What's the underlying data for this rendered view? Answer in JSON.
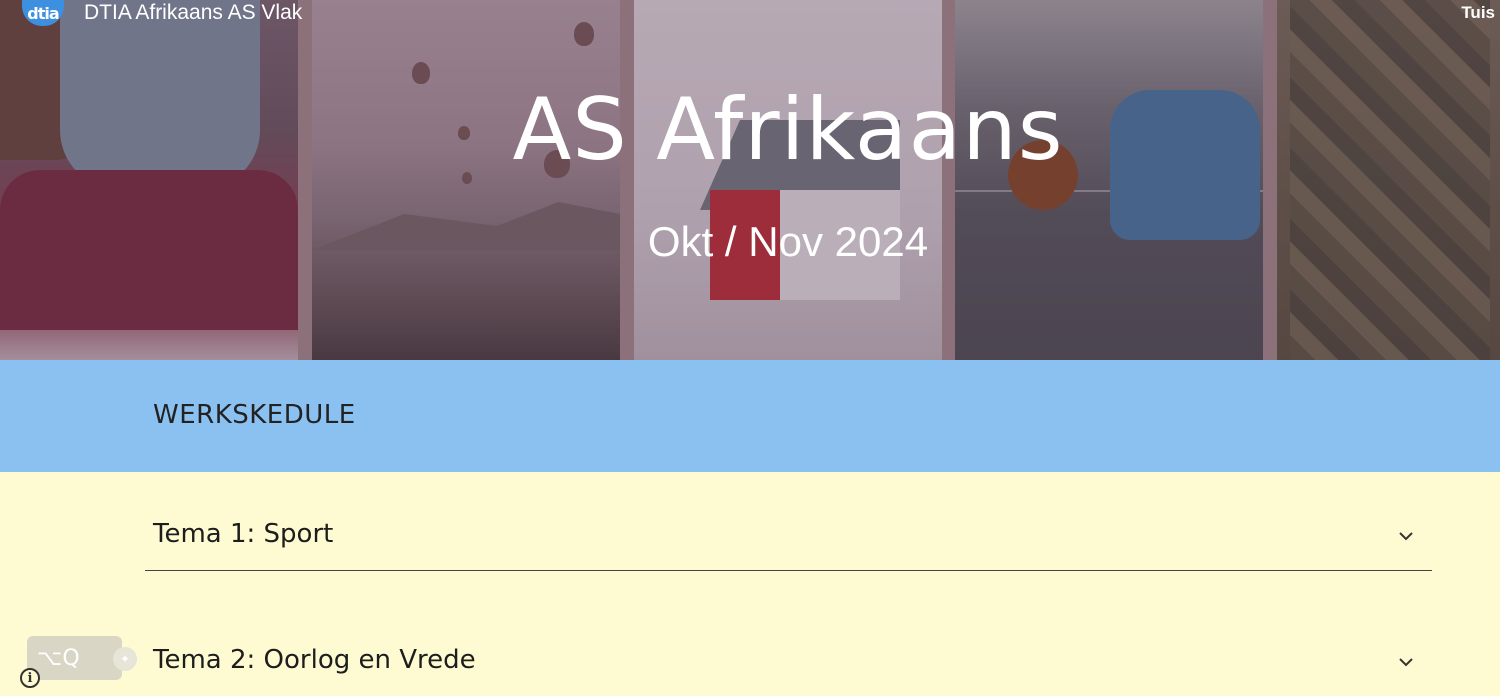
{
  "header": {
    "logo_text": "dtia",
    "site_title": "DTIA Afrikaans AS Vlak",
    "nav_home": "Tuis"
  },
  "hero": {
    "title": "AS Afrikaans",
    "subtitle": "Okt / Nov 2024"
  },
  "section": {
    "title": "WERKSKEDULE"
  },
  "accordion": {
    "items": [
      {
        "label": "Tema 1: Sport"
      },
      {
        "label": "Tema 2: Oorlog en Vrede"
      }
    ]
  },
  "widget": {
    "shortcut": "⌥Q"
  },
  "colors": {
    "band": "#8bc1f0",
    "page_bg": "#fefbd2",
    "logo": "#3d8fe0"
  },
  "icons": {
    "accordion_toggle": "chevron-down-icon",
    "info": "info-icon"
  }
}
